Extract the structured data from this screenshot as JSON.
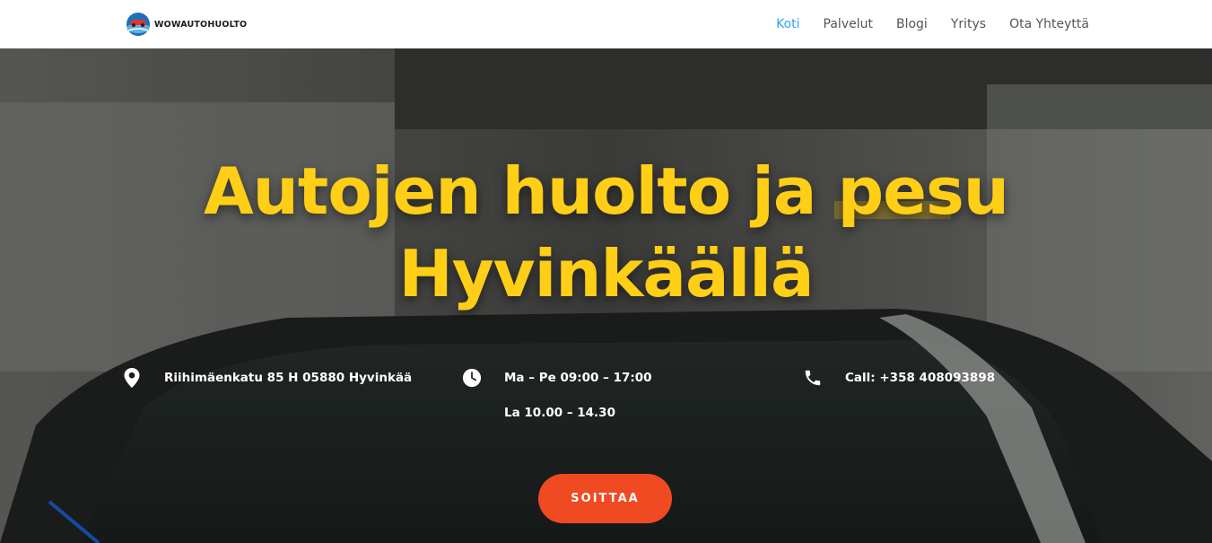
{
  "header": {
    "logo_text": "WOWAUTOHUOLTO",
    "nav": [
      {
        "label": "Koti",
        "active": true
      },
      {
        "label": "Palvelut",
        "active": false
      },
      {
        "label": "Blogi",
        "active": false
      },
      {
        "label": "Yritys",
        "active": false
      },
      {
        "label": "Ota Yhteyttä",
        "active": false
      }
    ]
  },
  "hero": {
    "headline_line1": "Autojen huolto ja pesu",
    "headline_line2": "Hyvinkäällä",
    "address": {
      "icon": "map-pin-icon",
      "text": "Riihimäenkatu 85 H 05880 Hyvinkää"
    },
    "hours": {
      "icon": "clock-icon",
      "line1": "Ma – Pe 09:00 – 17:00",
      "line2": "La 10.00 – 14.30"
    },
    "phone": {
      "icon": "phone-icon",
      "text": "Call: +358 408093898"
    },
    "cta_label": "SOITTAA"
  },
  "colors": {
    "headline": "#ffce16",
    "cta": "#f04a22",
    "nav_active": "#2ea3f2"
  }
}
